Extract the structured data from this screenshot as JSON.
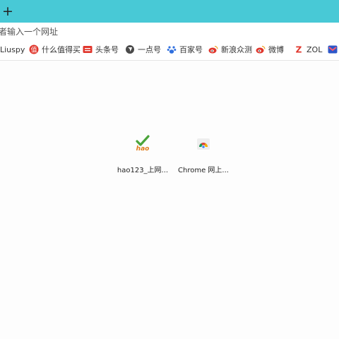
{
  "tab_bar": {
    "new_tab_glyph": "+"
  },
  "address": {
    "placeholder": "者输入一个网址"
  },
  "bookmarks": [
    {
      "label": "Liuspy",
      "icon": "none"
    },
    {
      "label": "什么值得买",
      "icon": "smzdm-icon"
    },
    {
      "label": "头条号",
      "icon": "toutiao-icon"
    },
    {
      "label": "一点号",
      "icon": "yidian-icon"
    },
    {
      "label": "百家号",
      "icon": "baidu-paw-icon"
    },
    {
      "label": "新浪众测",
      "icon": "weibo-icon"
    },
    {
      "label": "微博",
      "icon": "weibo-icon"
    },
    {
      "label": "ZOL",
      "icon": "zol-icon"
    }
  ],
  "tiles": [
    {
      "label": "hao123_上网...",
      "icon": "hao123-icon"
    },
    {
      "label": "Chrome 网上...",
      "icon": "chrome-store-icon"
    }
  ],
  "colors": {
    "tab_bar": "#48c9d6",
    "accent_red": "#e0362c"
  }
}
